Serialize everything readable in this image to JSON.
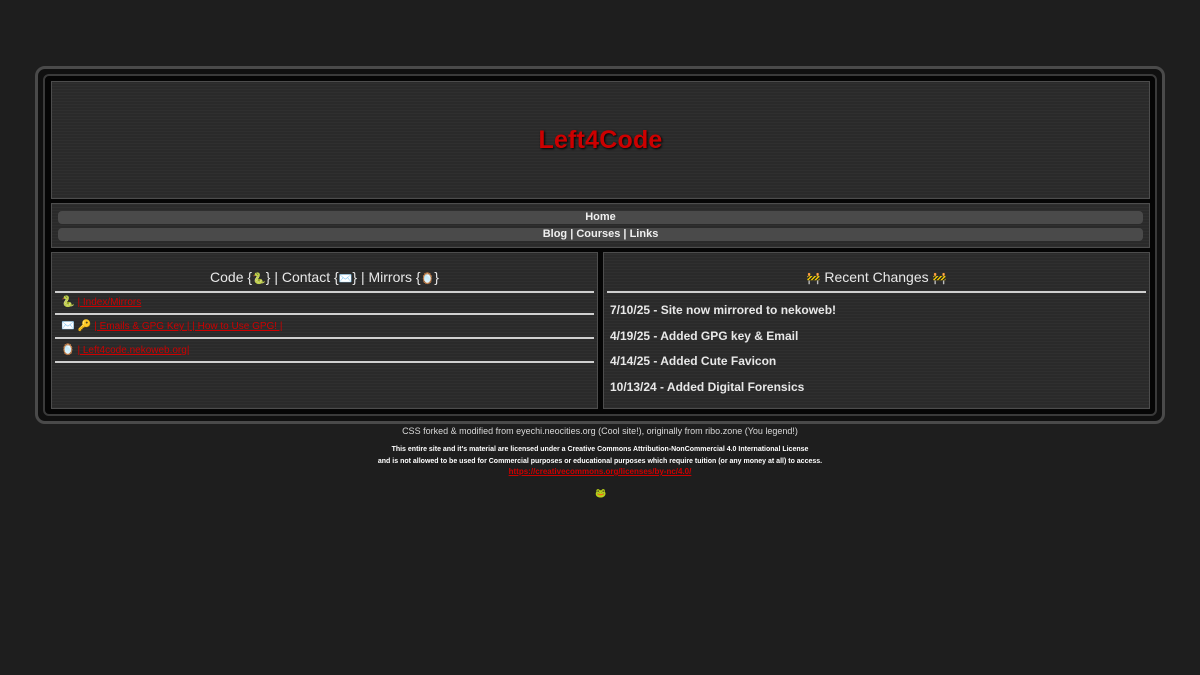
{
  "header": {
    "title": "Left4Code"
  },
  "nav": {
    "home": "Home",
    "blog": "Blog",
    "sep1": " | ",
    "courses": "Courses",
    "sep2": " | ",
    "links": "Links"
  },
  "left_panel": {
    "heading": {
      "code_label": "Code {",
      "code_icon": "🐍",
      "code_close": "} | Contact {",
      "contact_icon": "✉️",
      "contact_close": "} | Mirrors {",
      "mirrors_icon": "🪞",
      "mirrors_close": "}"
    },
    "rows": [
      {
        "icons": "🐍",
        "link": "| Index/Mirrors"
      },
      {
        "icons": "✉️ 🔑",
        "link": "| Emails & GPG Key | | How to Use GPG! |"
      },
      {
        "icons": "🪞",
        "link": "| Left4code.nekoweb.org|"
      }
    ]
  },
  "right_panel": {
    "heading_icon_left": "🚧",
    "heading": "Recent Changes",
    "heading_icon_right": "🚧",
    "changes": [
      "7/10/25 - Site now mirrored to nekoweb!",
      "4/19/25 - Added GPG key & Email",
      "4/14/25 - Added Cute Favicon",
      "10/13/24 - Added Digital Forensics"
    ]
  },
  "footer": {
    "credit": "CSS forked & modified from eyechi.neocities.org (Cool site!), originally from ribo.zone (You legend!)",
    "license_line1": "This entire site and it's material are licensed under a Creative Commons Attribution-NonCommercial 4.0 International License",
    "license_line2": "and is not allowed to be used for Commercial purposes or educational purposes which require tuition (or any money at all) to access.",
    "license_url": "https://creativecommons.org/licenses/by-nc/4.0/",
    "badge_icon": "🐸"
  }
}
